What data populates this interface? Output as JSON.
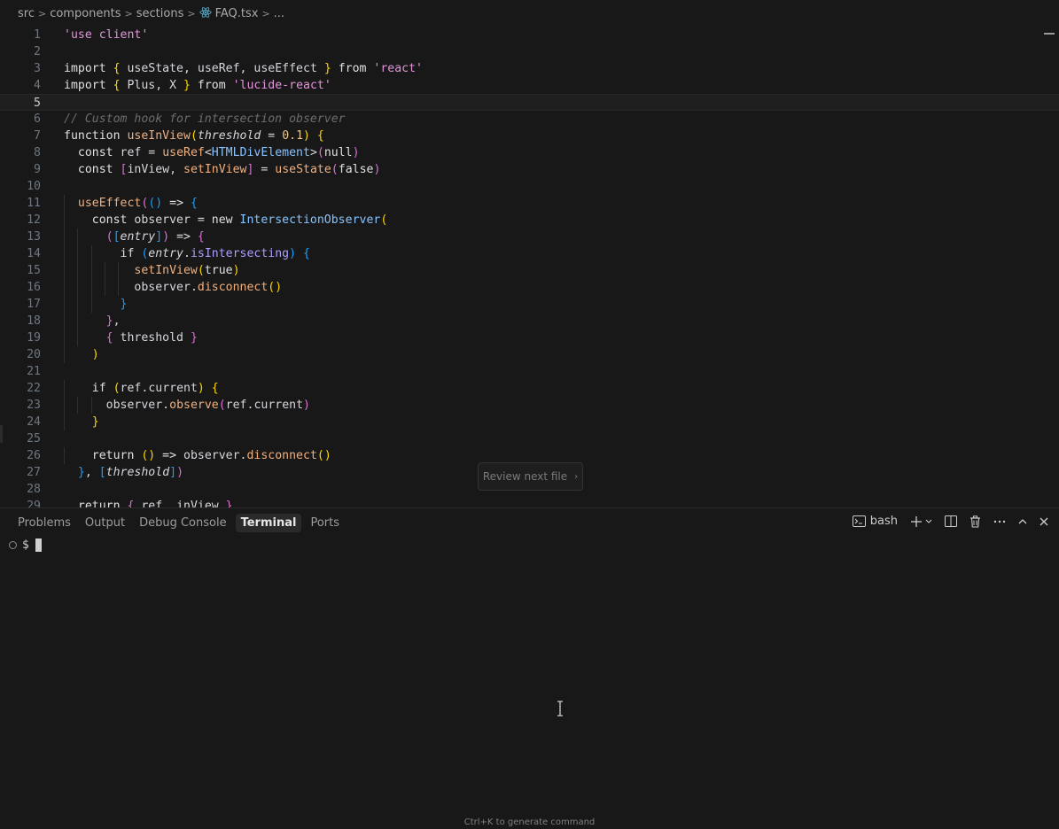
{
  "breadcrumb": {
    "items": [
      "src",
      "components",
      "sections",
      "FAQ.tsx",
      "..."
    ],
    "separator": ">"
  },
  "editor": {
    "active_line": 5,
    "lines": [
      {
        "n": "1",
        "t": [
          [
            "'use client'",
            "str"
          ]
        ]
      },
      {
        "n": "2",
        "t": []
      },
      {
        "n": "3",
        "t": [
          [
            "import ",
            "kw"
          ],
          [
            "{ ",
            "b1"
          ],
          [
            "useState",
            "var"
          ],
          [
            ", ",
            "p"
          ],
          [
            "useRef",
            "var"
          ],
          [
            ", ",
            "p"
          ],
          [
            "useEffect",
            "var"
          ],
          [
            " }",
            "b1"
          ],
          [
            " from ",
            "kw"
          ],
          [
            "'react'",
            "str"
          ]
        ]
      },
      {
        "n": "4",
        "t": [
          [
            "import ",
            "kw"
          ],
          [
            "{ ",
            "b1"
          ],
          [
            "Plus",
            "var"
          ],
          [
            ", ",
            "p"
          ],
          [
            "X",
            "var"
          ],
          [
            " }",
            "b1"
          ],
          [
            " from ",
            "kw"
          ],
          [
            "'lucide-react'",
            "str"
          ]
        ]
      },
      {
        "n": "5",
        "t": []
      },
      {
        "n": "6",
        "t": [
          [
            "// Custom hook for intersection observer",
            "cm"
          ]
        ]
      },
      {
        "n": "7",
        "t": [
          [
            "function ",
            "kw"
          ],
          [
            "useInView",
            "fn"
          ],
          [
            "(",
            "b1"
          ],
          [
            "threshold",
            "prm"
          ],
          [
            " = ",
            "p"
          ],
          [
            "0.1",
            "num"
          ],
          [
            ")",
            "b1"
          ],
          [
            " {",
            "b1"
          ]
        ]
      },
      {
        "n": "8",
        "t": [
          [
            "  const ",
            "kw"
          ],
          [
            "ref",
            "var"
          ],
          [
            " = ",
            "p"
          ],
          [
            "useRef",
            "fn"
          ],
          [
            "<",
            "p"
          ],
          [
            "HTMLDivElement",
            "typ"
          ],
          [
            ">",
            "p"
          ],
          [
            "(",
            "b2"
          ],
          [
            "null",
            "kw"
          ],
          [
            ")",
            "b2"
          ]
        ]
      },
      {
        "n": "9",
        "t": [
          [
            "  const ",
            "kw"
          ],
          [
            "[",
            "b2"
          ],
          [
            "inView",
            "var"
          ],
          [
            ", ",
            "p"
          ],
          [
            "setInView",
            "fn"
          ],
          [
            "]",
            "b2"
          ],
          [
            " = ",
            "p"
          ],
          [
            "useState",
            "fn"
          ],
          [
            "(",
            "b2"
          ],
          [
            "false",
            "kw"
          ],
          [
            ")",
            "b2"
          ]
        ]
      },
      {
        "n": "10",
        "t": []
      },
      {
        "n": "11",
        "t": [
          [
            "  ",
            "p"
          ],
          [
            "useEffect",
            "fn"
          ],
          [
            "(",
            "b2"
          ],
          [
            "()",
            "b3"
          ],
          [
            " => ",
            "kw"
          ],
          [
            "{",
            "b3"
          ]
        ]
      },
      {
        "n": "12",
        "t": [
          [
            "    const ",
            "kw"
          ],
          [
            "observer",
            "var"
          ],
          [
            " = ",
            "p"
          ],
          [
            "new ",
            "kw"
          ],
          [
            "IntersectionObserver",
            "typ"
          ],
          [
            "(",
            "b1"
          ]
        ]
      },
      {
        "n": "13",
        "t": [
          [
            "      (",
            "b2"
          ],
          [
            "[",
            "b3"
          ],
          [
            "entry",
            "prm"
          ],
          [
            "]",
            "b3"
          ],
          [
            ")",
            "b2"
          ],
          [
            " => ",
            "kw"
          ],
          [
            "{",
            "b2"
          ]
        ]
      },
      {
        "n": "14",
        "t": [
          [
            "        if ",
            "kw"
          ],
          [
            "(",
            "b3"
          ],
          [
            "entry",
            "prm"
          ],
          [
            ".",
            "p"
          ],
          [
            "isIntersecting",
            "prop"
          ],
          [
            ")",
            "b3"
          ],
          [
            " {",
            "b3"
          ]
        ]
      },
      {
        "n": "15",
        "t": [
          [
            "          ",
            "p"
          ],
          [
            "setInView",
            "fn"
          ],
          [
            "(",
            "b1"
          ],
          [
            "true",
            "kw"
          ],
          [
            ")",
            "b1"
          ]
        ]
      },
      {
        "n": "16",
        "t": [
          [
            "          ",
            "p"
          ],
          [
            "observer",
            "var"
          ],
          [
            ".",
            "p"
          ],
          [
            "disconnect",
            "fn"
          ],
          [
            "()",
            "b1"
          ]
        ]
      },
      {
        "n": "17",
        "t": [
          [
            "        }",
            "b3"
          ]
        ]
      },
      {
        "n": "18",
        "t": [
          [
            "      }",
            "b2"
          ],
          [
            ",",
            "p"
          ]
        ]
      },
      {
        "n": "19",
        "t": [
          [
            "      { ",
            "b2"
          ],
          [
            "threshold",
            "var"
          ],
          [
            " }",
            "b2"
          ]
        ]
      },
      {
        "n": "20",
        "t": [
          [
            "    )",
            "b1"
          ]
        ]
      },
      {
        "n": "21",
        "t": []
      },
      {
        "n": "22",
        "t": [
          [
            "    if ",
            "kw"
          ],
          [
            "(",
            "b1"
          ],
          [
            "ref",
            "var"
          ],
          [
            ".",
            "p"
          ],
          [
            "current",
            "var"
          ],
          [
            ")",
            "b1"
          ],
          [
            " {",
            "b1"
          ]
        ]
      },
      {
        "n": "23",
        "t": [
          [
            "      ",
            "p"
          ],
          [
            "observer",
            "var"
          ],
          [
            ".",
            "p"
          ],
          [
            "observe",
            "fn"
          ],
          [
            "(",
            "b2"
          ],
          [
            "ref",
            "var"
          ],
          [
            ".",
            "p"
          ],
          [
            "current",
            "var"
          ],
          [
            ")",
            "b2"
          ]
        ]
      },
      {
        "n": "24",
        "t": [
          [
            "    }",
            "b1"
          ]
        ]
      },
      {
        "n": "25",
        "t": []
      },
      {
        "n": "26",
        "t": [
          [
            "    return ",
            "kw"
          ],
          [
            "()",
            "b1"
          ],
          [
            " => ",
            "kw"
          ],
          [
            "observer",
            "var"
          ],
          [
            ".",
            "p"
          ],
          [
            "disconnect",
            "fn"
          ],
          [
            "()",
            "b1"
          ]
        ]
      },
      {
        "n": "27",
        "t": [
          [
            "  }",
            "b3"
          ],
          [
            ", ",
            "p"
          ],
          [
            "[",
            "b3"
          ],
          [
            "threshold",
            "prm"
          ],
          [
            "]",
            "b3"
          ],
          [
            ")",
            "b2"
          ]
        ]
      },
      {
        "n": "28",
        "t": []
      },
      {
        "n": "29",
        "t": [
          [
            "  return ",
            "kw"
          ],
          [
            "{ ",
            "b2"
          ],
          [
            "ref",
            "var"
          ],
          [
            ", ",
            "p"
          ],
          [
            "inView",
            "var"
          ],
          [
            " }",
            "b2"
          ]
        ]
      }
    ]
  },
  "review_button": {
    "label": "Review next file",
    "chevron": "›"
  },
  "panel": {
    "tabs": [
      "Problems",
      "Output",
      "Debug Console",
      "Terminal",
      "Ports"
    ],
    "active_tab": "Terminal",
    "shell_label": "bash",
    "prompt": "$"
  },
  "hint": "Ctrl+K to generate command",
  "icons": {
    "file": "react-file-icon",
    "terminal": "terminal-icon",
    "add": "plus-icon",
    "split": "split-terminal-icon",
    "trash": "trash-icon",
    "more": "ellipsis-icon",
    "maximize": "chevron-up-icon",
    "close": "close-icon"
  },
  "colors": {
    "accent_file_icon": "#519aba",
    "background": "#181818"
  }
}
